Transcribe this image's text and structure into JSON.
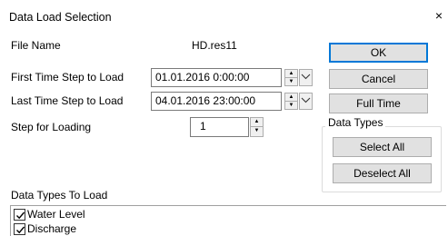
{
  "dialog": {
    "title": "Data Load Selection",
    "close_glyph": "×"
  },
  "fields": {
    "file_name_label": "File Name",
    "file_name_value": "HD.res11",
    "first_step_label": "First Time Step to Load",
    "first_step_value": "01.01.2016  0:00:00",
    "last_step_label": "Last Time Step to Load",
    "last_step_value": "04.01.2016 23:00:00",
    "step_loading_label": "Step for Loading",
    "step_loading_value": "1"
  },
  "buttons": {
    "ok": "OK",
    "cancel": "Cancel",
    "full_time": "Full Time",
    "select_all": "Select All",
    "deselect_all": "Deselect All"
  },
  "data_types_group": {
    "title": "Data Types"
  },
  "data_types_to_load": {
    "label": "Data Types To Load",
    "items": [
      {
        "label": "Water Level",
        "checked": true
      },
      {
        "label": "Discharge",
        "checked": true
      }
    ]
  },
  "colors": {
    "accent_border": "#0078d7",
    "button_face": "#e1e1e1"
  }
}
